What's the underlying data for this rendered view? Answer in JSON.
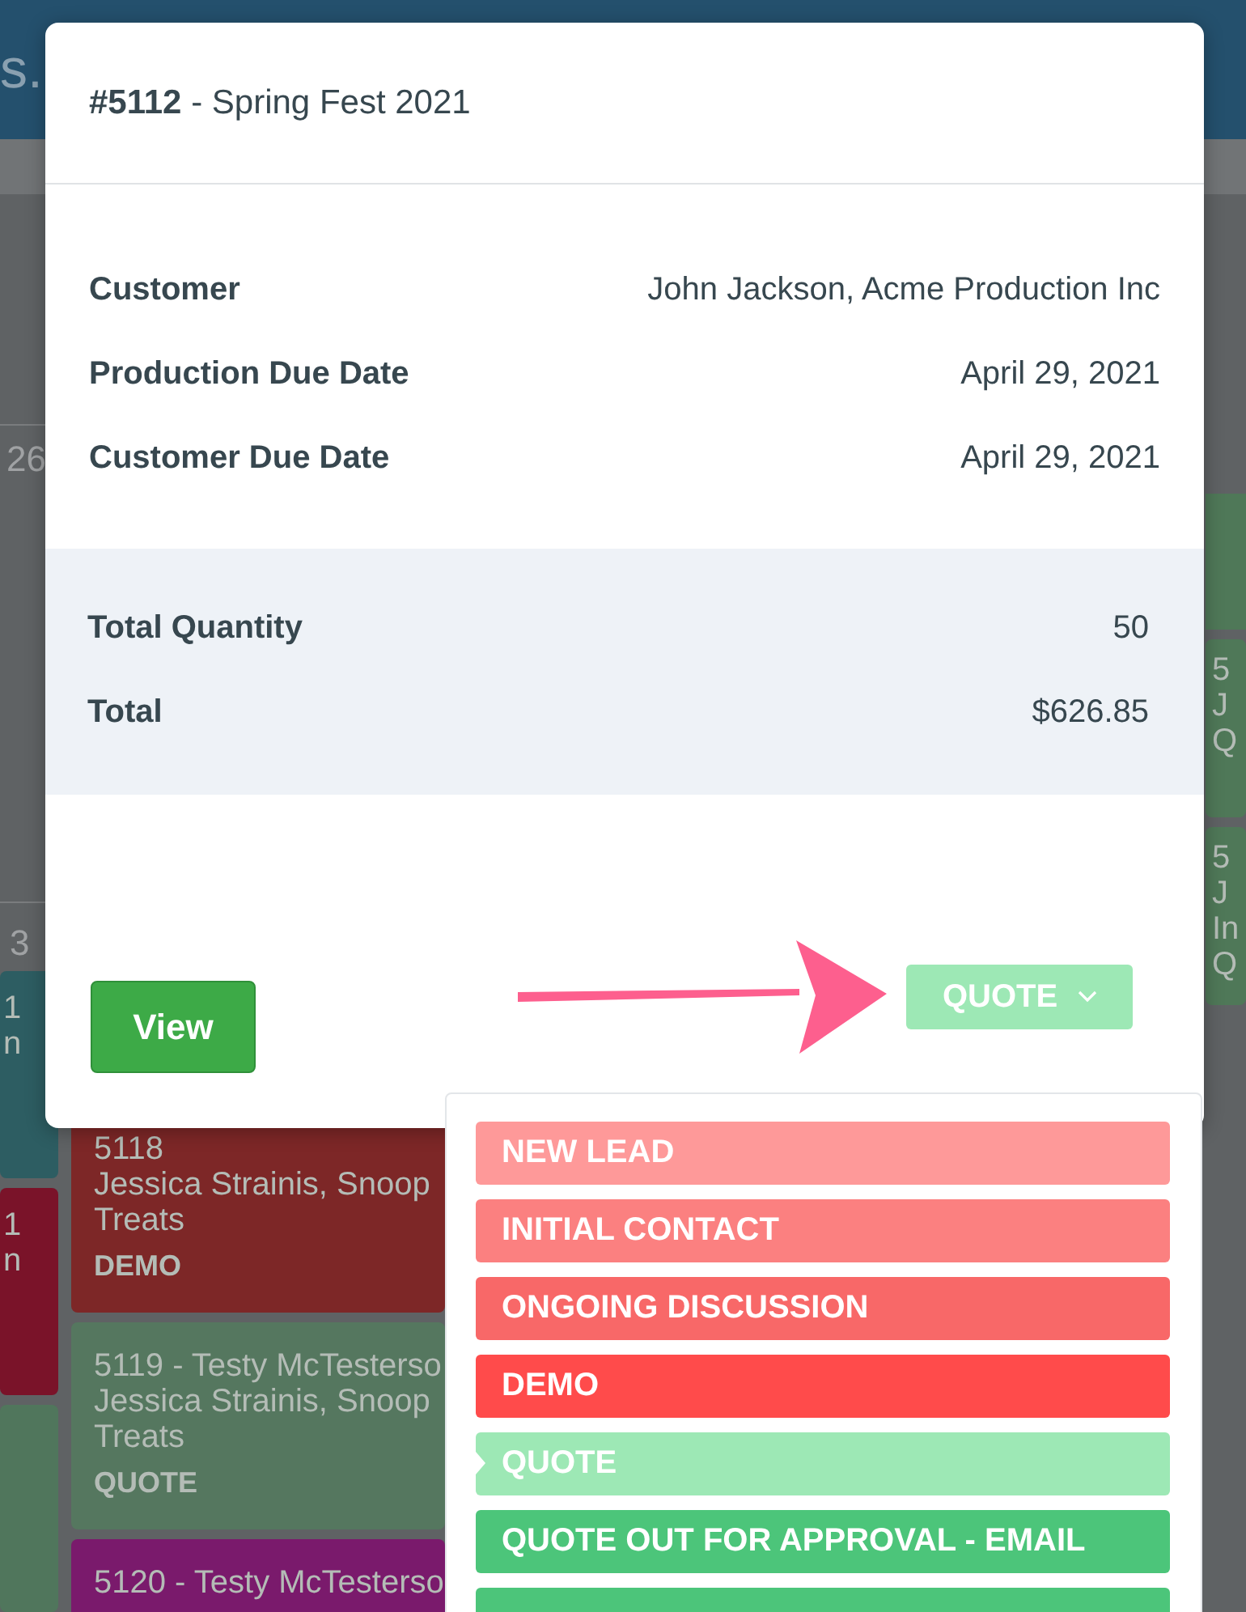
{
  "calendar": {
    "header_fragment": "s.",
    "week_labels": [
      "26",
      "3"
    ],
    "columns": [
      {
        "cards": [
          {
            "color": "#2d5d62",
            "lines": [
              "1",
              "n"
            ]
          },
          {
            "color": "#7a1329",
            "lines": [
              "1",
              "n"
            ]
          },
          {
            "color": "#50765c"
          }
        ]
      },
      {
        "cards": [
          {
            "color": "#7d2727",
            "lines": [
              "5118",
              "Jessica Strainis, Snoop",
              "Treats",
              "DEMO"
            ]
          },
          {
            "color": "#55775f",
            "lines": [
              "5119 - Testy McTesterso",
              "Jessica Strainis, Snoop",
              "Treats",
              "QUOTE"
            ]
          },
          {
            "color": "#7a1a6c",
            "lines": [
              "5120 - Testy McTesterso"
            ]
          }
        ]
      },
      {
        "cards": [
          {
            "color": "#4f7858",
            "lines": [
              "5",
              "J",
              "Q"
            ]
          },
          {
            "color": "#4f7858",
            "lines": [
              "5",
              "J",
              "In",
              "Q"
            ]
          }
        ]
      }
    ]
  },
  "modal": {
    "order_number": "#5112",
    "title": " - Spring Fest 2021",
    "details": [
      {
        "label": "Customer",
        "value": "John Jackson, Acme Production Inc"
      },
      {
        "label": "Production Due Date",
        "value": "April 29, 2021"
      },
      {
        "label": "Customer Due Date",
        "value": "April 29, 2021"
      }
    ],
    "totals": [
      {
        "label": "Total Quantity",
        "value": "50"
      },
      {
        "label": "Total",
        "value": "$626.85"
      }
    ],
    "view_button": "View",
    "status_button": {
      "label": "QUOTE",
      "color": "#9de8b5"
    }
  },
  "status_menu": {
    "items": [
      {
        "label": "NEW LEAD",
        "color": "#fe9999",
        "selected": false
      },
      {
        "label": "INITIAL CONTACT",
        "color": "#fb8080",
        "selected": false
      },
      {
        "label": "ONGOING DISCUSSION",
        "color": "#f86868",
        "selected": false
      },
      {
        "label": "DEMO",
        "color": "#ff4b4b",
        "selected": false
      },
      {
        "label": "QUOTE",
        "color": "#9de8b5",
        "selected": true
      },
      {
        "label": "QUOTE OUT FOR APPROVAL - EMAIL",
        "color": "#4cc57a",
        "selected": false
      },
      {
        "color": "#4cc57a",
        "selected": false
      }
    ]
  }
}
